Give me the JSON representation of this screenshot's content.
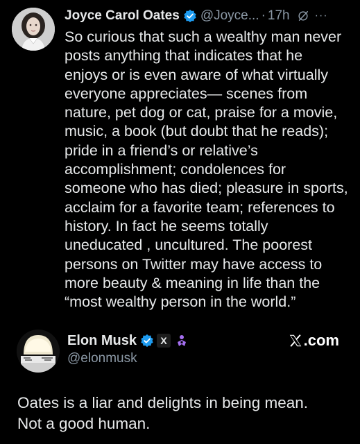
{
  "tweet1": {
    "author_name": "Joyce Carol Oates",
    "handle": "@Joyce...",
    "separator": "·",
    "time": "17h",
    "more": "···",
    "avatar_icon": "author-avatar",
    "lines": [
      "So curious that such a wealthy man never",
      "posts anything that indicates that he",
      "enjoys or is even aware of what virtually",
      "everyone appreciates— scenes from",
      "nature, pet dog or cat, praise for a movie,",
      "music, a book (but doubt that he reads);",
      "pride in a friend’s or relative’s",
      "accomplishment; condolences for",
      "someone who has died; pleasure in sports,",
      "acclaim for a favorite team;  references to",
      "history.  In fact he seems totally",
      "uneducated , uncultured. The poorest",
      "persons on Twitter may have access to",
      "more beauty & meaning in life than the",
      "“most wealthy person in the world.”"
    ]
  },
  "tweet2": {
    "author_name": "Elon Musk",
    "badge": "X",
    "handle": "@elonmusk",
    "site_label": ".com",
    "lines": [
      "Oates is a liar and delights in being mean.",
      "Not a good human."
    ]
  },
  "colors": {
    "background": "#000000",
    "text": "#e7e9ea",
    "secondary": "#8b98a5",
    "verified_blue": "#1d9bf0",
    "affiliate_purple": "#a56ff0"
  }
}
